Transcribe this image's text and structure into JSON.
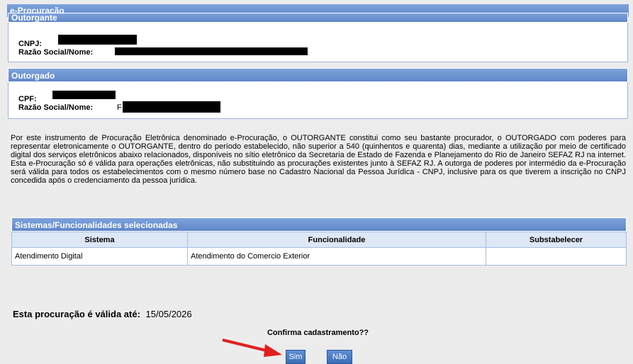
{
  "header": {
    "title": "e-Procuração"
  },
  "outorgante": {
    "section_title": "Outorgante",
    "cnpj_label": "CNPJ:",
    "razao_label": "Razão Social/Nome:"
  },
  "outorgado": {
    "section_title": "Outorgado",
    "cpf_label": "CPF:",
    "razao_label": "Razão Social/Nome:",
    "razao_prefix": "F"
  },
  "legal_text": "Por este instrumento de Procuração Eletrônica denominado e-Procuração, o OUTORGANTE constitui como seu bastante procurador, o OUTORGADO com poderes para representar eletronicamente o OUTORGANTE, dentro do período estabelecido, não superior a 540 (quinhentos e quarenta) dias, mediante a utilização por meio de certificado digital dos serviços eletrônicos abaixo relacionados, disponíveis no sítio eletrônico da Secretaria de Estado de Fazenda e Planejamento do Rio de Janeiro SEFAZ RJ na internet. Esta e-Procuração só é válida para operações eletrônicas, não substituindo as procurações existentes junto à SEFAZ RJ. A outorga de poderes por intermédio da e-Procuração será válida para todos os estabelecimentos com o mesmo número base no Cadastro Nacional da Pessoa Jurídica - CNPJ, inclusive para os que tiverem a inscrição no CNPJ concedida após o credenciamento da pessoa jurídica.",
  "sistemas": {
    "section_title": "Sistemas/Funcionalidades selecionadas",
    "columns": [
      "Sistema",
      "Funcionalidade",
      "Substabelecer"
    ],
    "rows": [
      [
        "Atendimento Digital",
        "Atendimento do Comercio Exterior",
        ""
      ]
    ]
  },
  "validity": {
    "label": "Esta procuração é válida até:",
    "date": "15/05/2026"
  },
  "confirm": {
    "question": "Confirma cadastramento??",
    "yes": "Sim",
    "no": "Não"
  },
  "colors": {
    "header_blue": "#6a90d0",
    "annotation_arrow": "#e02020"
  }
}
